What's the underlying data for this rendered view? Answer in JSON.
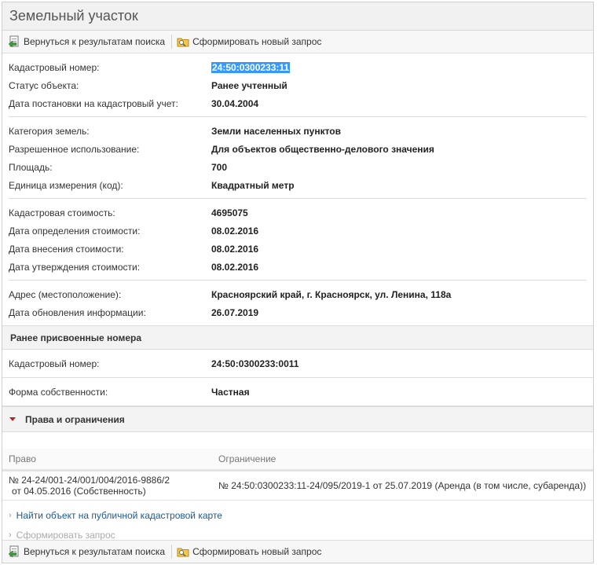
{
  "page_title": "Земельный участок",
  "toolbar": {
    "back_label": "Вернуться к результатам поиска",
    "new_request_label": "Сформировать новый запрос"
  },
  "groups": [
    [
      {
        "label": "Кадастровый номер:",
        "value": "24:50:0300233:11",
        "selected": true
      },
      {
        "label": "Статус объекта:",
        "value": "Ранее учтенный"
      },
      {
        "label": "Дата постановки на кадастровый учет:",
        "value": "30.04.2004"
      }
    ],
    [
      {
        "label": "Категория земель:",
        "value": "Земли населенных пунктов"
      },
      {
        "label": "Разрешенное использование:",
        "value": "Для объектов общественно-делового значения"
      },
      {
        "label": "Площадь:",
        "value": "700"
      },
      {
        "label": "Единица измерения (код):",
        "value": "Квадратный метр"
      }
    ],
    [
      {
        "label": "Кадастровая стоимость:",
        "value": "4695075"
      },
      {
        "label": "Дата определения стоимости:",
        "value": "08.02.2016"
      },
      {
        "label": "Дата внесения стоимости:",
        "value": "08.02.2016"
      },
      {
        "label": "Дата утверждения стоимости:",
        "value": "08.02.2016"
      }
    ],
    [
      {
        "label": "Адрес (местоположение):",
        "value": "Красноярский край, г. Красноярск, ул. Ленина, 118а"
      },
      {
        "label": "Дата обновления информации:",
        "value": "26.07.2019"
      }
    ]
  ],
  "previous_numbers": {
    "heading": "Ранее присвоенные номера",
    "label": "Кадастровый номер:",
    "value": "24:50:0300233:0011"
  },
  "ownership": {
    "label": "Форма собственности:",
    "value": "Частная"
  },
  "rights": {
    "heading": "Права и ограничения",
    "columns": [
      "Право",
      "Ограничение"
    ],
    "right_line1": "№ 24-24/001-24/001/004/2016-9886/2",
    "right_line2": "от 04.05.2016  (Собственность)",
    "restriction": "№ 24:50:0300233:11-24/095/2019-1  от 25.07.2019  (Аренда (в том числе, субаренда))"
  },
  "links": {
    "map_link": "Найти объект на публичной кадастровой карте",
    "request_link": "Сформировать запрос"
  },
  "icons": {
    "back": "back-arrow-icon",
    "new_request": "folder-search-icon"
  }
}
